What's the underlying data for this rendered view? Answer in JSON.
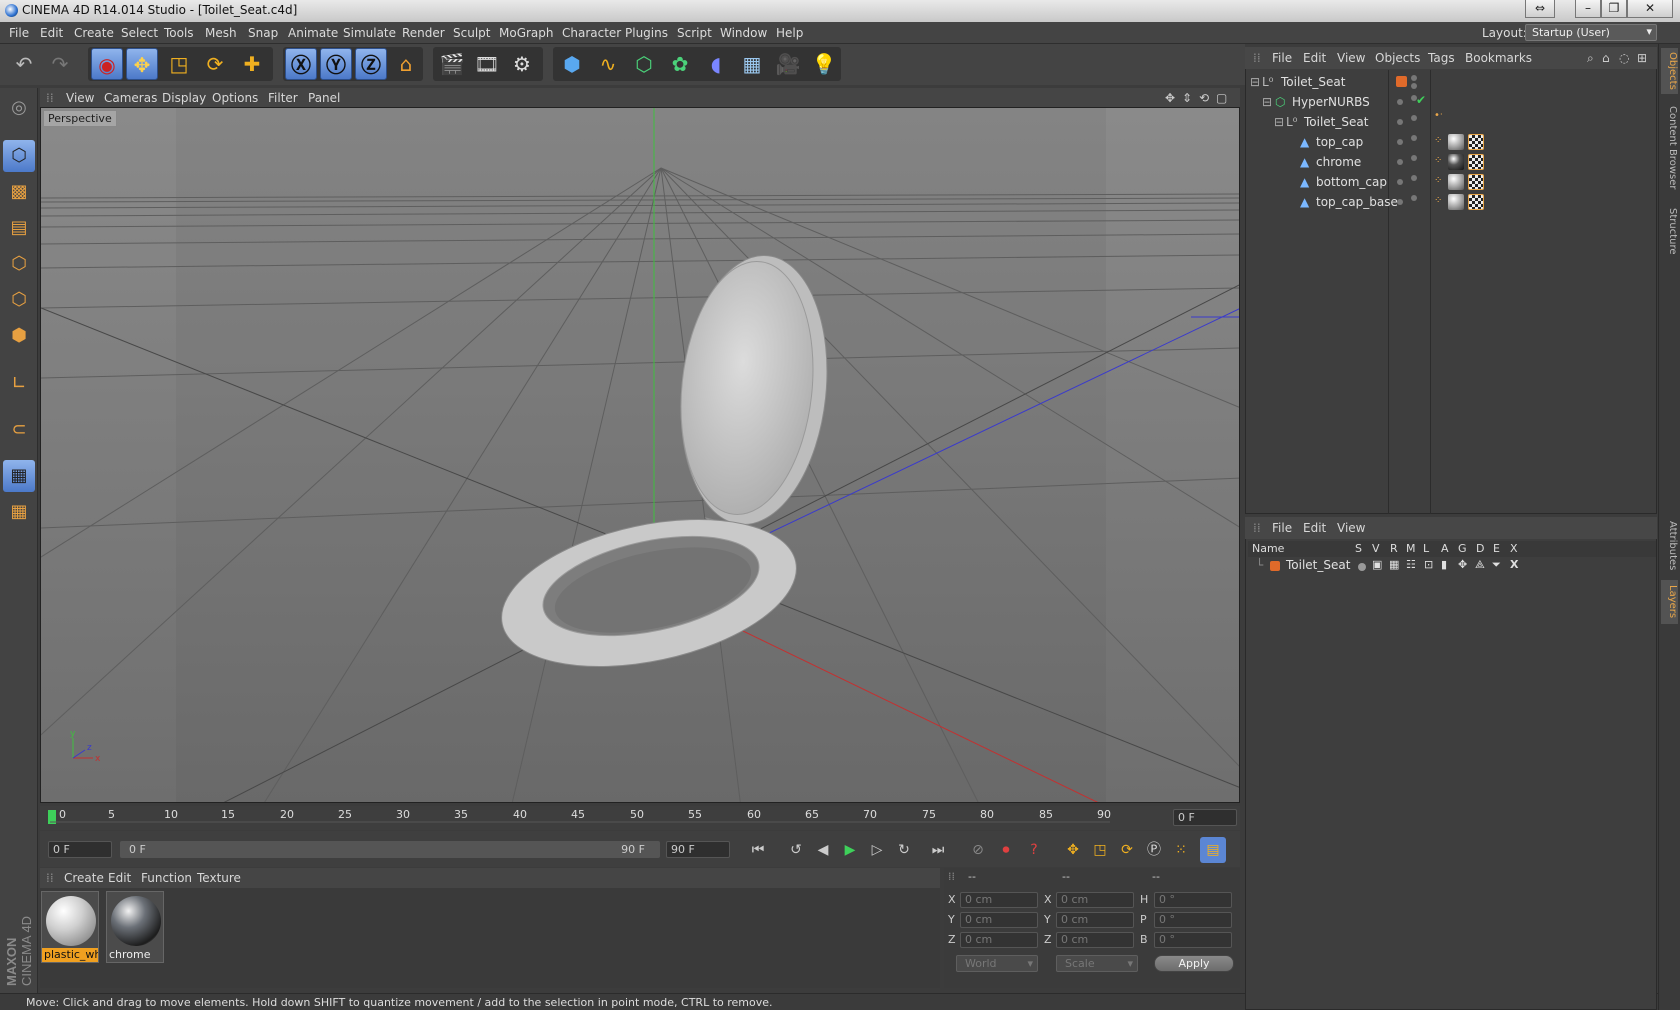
{
  "window": {
    "title": "CINEMA 4D R14.014 Studio - [Toilet_Seat.c4d]"
  },
  "menubar": {
    "items": [
      "File",
      "Edit",
      "Create",
      "Select",
      "Tools",
      "Mesh",
      "Snap",
      "Animate",
      "Simulate",
      "Render",
      "Sculpt",
      "MoGraph",
      "Character",
      "Plugins",
      "Script",
      "Window",
      "Help"
    ],
    "layout_label": "Layout:",
    "layout_value": "Startup (User)"
  },
  "viewport": {
    "menu": [
      "View",
      "Cameras",
      "Display",
      "Options",
      "Filter",
      "Panel"
    ],
    "label": "Perspective"
  },
  "timeline": {
    "ticks": [
      "0",
      "5",
      "10",
      "15",
      "20",
      "25",
      "30",
      "35",
      "40",
      "45",
      "50",
      "55",
      "60",
      "65",
      "70",
      "75",
      "80",
      "85",
      "90"
    ],
    "current_frame": "0 F",
    "start_field": "0 F",
    "range_start": "0 F",
    "range_end": "90 F",
    "end_field": "90 F"
  },
  "materials": {
    "menu": [
      "Create",
      "Edit",
      "Function",
      "Texture"
    ],
    "items": [
      {
        "name": "plastic_whi",
        "color": "#e8e8e8",
        "selected": true
      },
      {
        "name": "chrome",
        "color": "#6b7077",
        "selected": false
      }
    ]
  },
  "coordinates": {
    "headers": [
      "--",
      "--",
      "--"
    ],
    "rows": [
      {
        "axis1": "X",
        "val1": "0 cm",
        "axis2": "X",
        "val2": "0 cm",
        "axis3": "H",
        "val3": "0 °"
      },
      {
        "axis1": "Y",
        "val1": "0 cm",
        "axis2": "Y",
        "val2": "0 cm",
        "axis3": "P",
        "val3": "0 °"
      },
      {
        "axis1": "Z",
        "val1": "0 cm",
        "axis2": "Z",
        "val2": "0 cm",
        "axis3": "B",
        "val3": "0 °"
      }
    ],
    "mode_world": "World",
    "mode_scale": "Scale",
    "apply": "Apply"
  },
  "object_manager": {
    "menu": [
      "File",
      "Edit",
      "View",
      "Objects",
      "Tags",
      "Bookmarks"
    ],
    "objects": [
      {
        "name": "Toilet_Seat",
        "indent": 0,
        "type": "null"
      },
      {
        "name": "HyperNURBS",
        "indent": 1,
        "type": "nurbs"
      },
      {
        "name": "Toilet_Seat",
        "indent": 2,
        "type": "null"
      },
      {
        "name": "top_cap",
        "indent": 3,
        "type": "poly"
      },
      {
        "name": "chrome",
        "indent": 3,
        "type": "poly"
      },
      {
        "name": "bottom_cap",
        "indent": 3,
        "type": "poly"
      },
      {
        "name": "top_cap_base",
        "indent": 3,
        "type": "poly"
      }
    ]
  },
  "layer_manager": {
    "menu": [
      "File",
      "Edit",
      "View"
    ],
    "columns": [
      "Name",
      "S",
      "V",
      "R",
      "M",
      "L",
      "A",
      "G",
      "D",
      "E",
      "X"
    ],
    "layers": [
      {
        "name": "Toilet_Seat",
        "color": "#e06a2a"
      }
    ]
  },
  "right_tabs": [
    "Objects",
    "Content Browser",
    "Structure",
    "Attributes",
    "Layers"
  ],
  "status": {
    "text": "Move: Click and drag to move elements. Hold down SHIFT to quantize movement / add to the selection in point mode, CTRL to remove."
  },
  "branding": {
    "maxon": "MAXON",
    "cinema": "CINEMA 4D"
  },
  "colors": {
    "accent": "#e8a64a",
    "selection": "#5b86d4"
  }
}
